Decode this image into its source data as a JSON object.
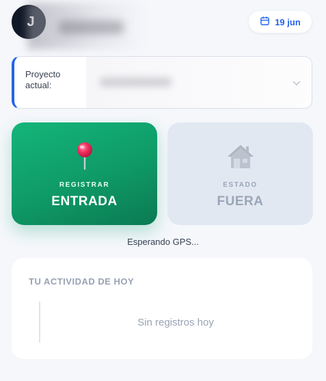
{
  "header": {
    "avatar_initial": "J",
    "date": "19 jun"
  },
  "project": {
    "label": "Proyecto actual:"
  },
  "checkin_tile": {
    "small_label": "REGISTRAR",
    "big_label": "ENTRADA",
    "icon": "pushpin-icon"
  },
  "status_tile": {
    "small_label": "ESTADO",
    "big_label": "FUERA",
    "icon": "house-icon"
  },
  "gps": {
    "status_text": "Esperando GPS..."
  },
  "activity": {
    "title": "TU ACTIVIDAD DE HOY",
    "empty_text": "Sin registros hoy"
  },
  "colors": {
    "accent": "#2563eb",
    "checkin_green": "#0f9a68",
    "status_gray": "#e2e8f1"
  }
}
